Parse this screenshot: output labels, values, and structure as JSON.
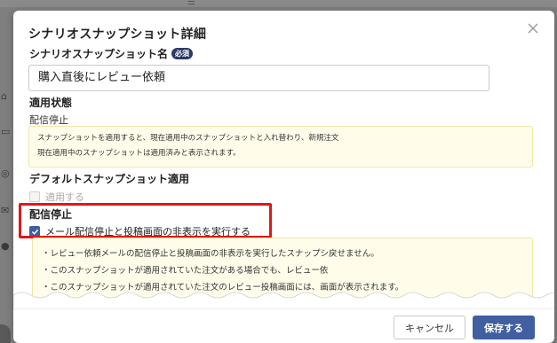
{
  "modal": {
    "title": "シナリオスナップショット詳細",
    "name_label": "シナリオスナップショット名",
    "required_badge": "必須",
    "name_value": "購入直後にレビュー依頼",
    "apply_status_label": "適用状態",
    "apply_status_value": "配信停止",
    "info_lines": [
      "スナップショットを適用すると、現在適用中のスナップショットと入れ替わり、新規注文",
      "現在適用中のスナップショットは適用済みと表示されます。"
    ],
    "default_label": "デフォルトスナップショット適用",
    "default_checkbox_label": "適用する",
    "default_checked": false,
    "stop_label": "配信停止",
    "stop_checkbox_label": "メール配信停止と投稿画面の非表示を実行する",
    "stop_checked": true,
    "warn_lines": [
      "・レビュー依頼メールの配信停止と投稿画面の非表示を実行したスナップシ",
      "・このスナップショットが適用されていた注文がある場合でも、レビュー依",
      "・このスナップショットが適用されていた注文のレビュー投稿画面には、"
    ],
    "warn_line_tails": [
      "戻せません。",
      "",
      "画面が表示されます。"
    ],
    "cancel_label": "キャンセル",
    "save_label": "保存する"
  },
  "colors": {
    "accent": "#3f5fa0",
    "highlight": "#e01818",
    "note_bg": "#fffdea"
  }
}
